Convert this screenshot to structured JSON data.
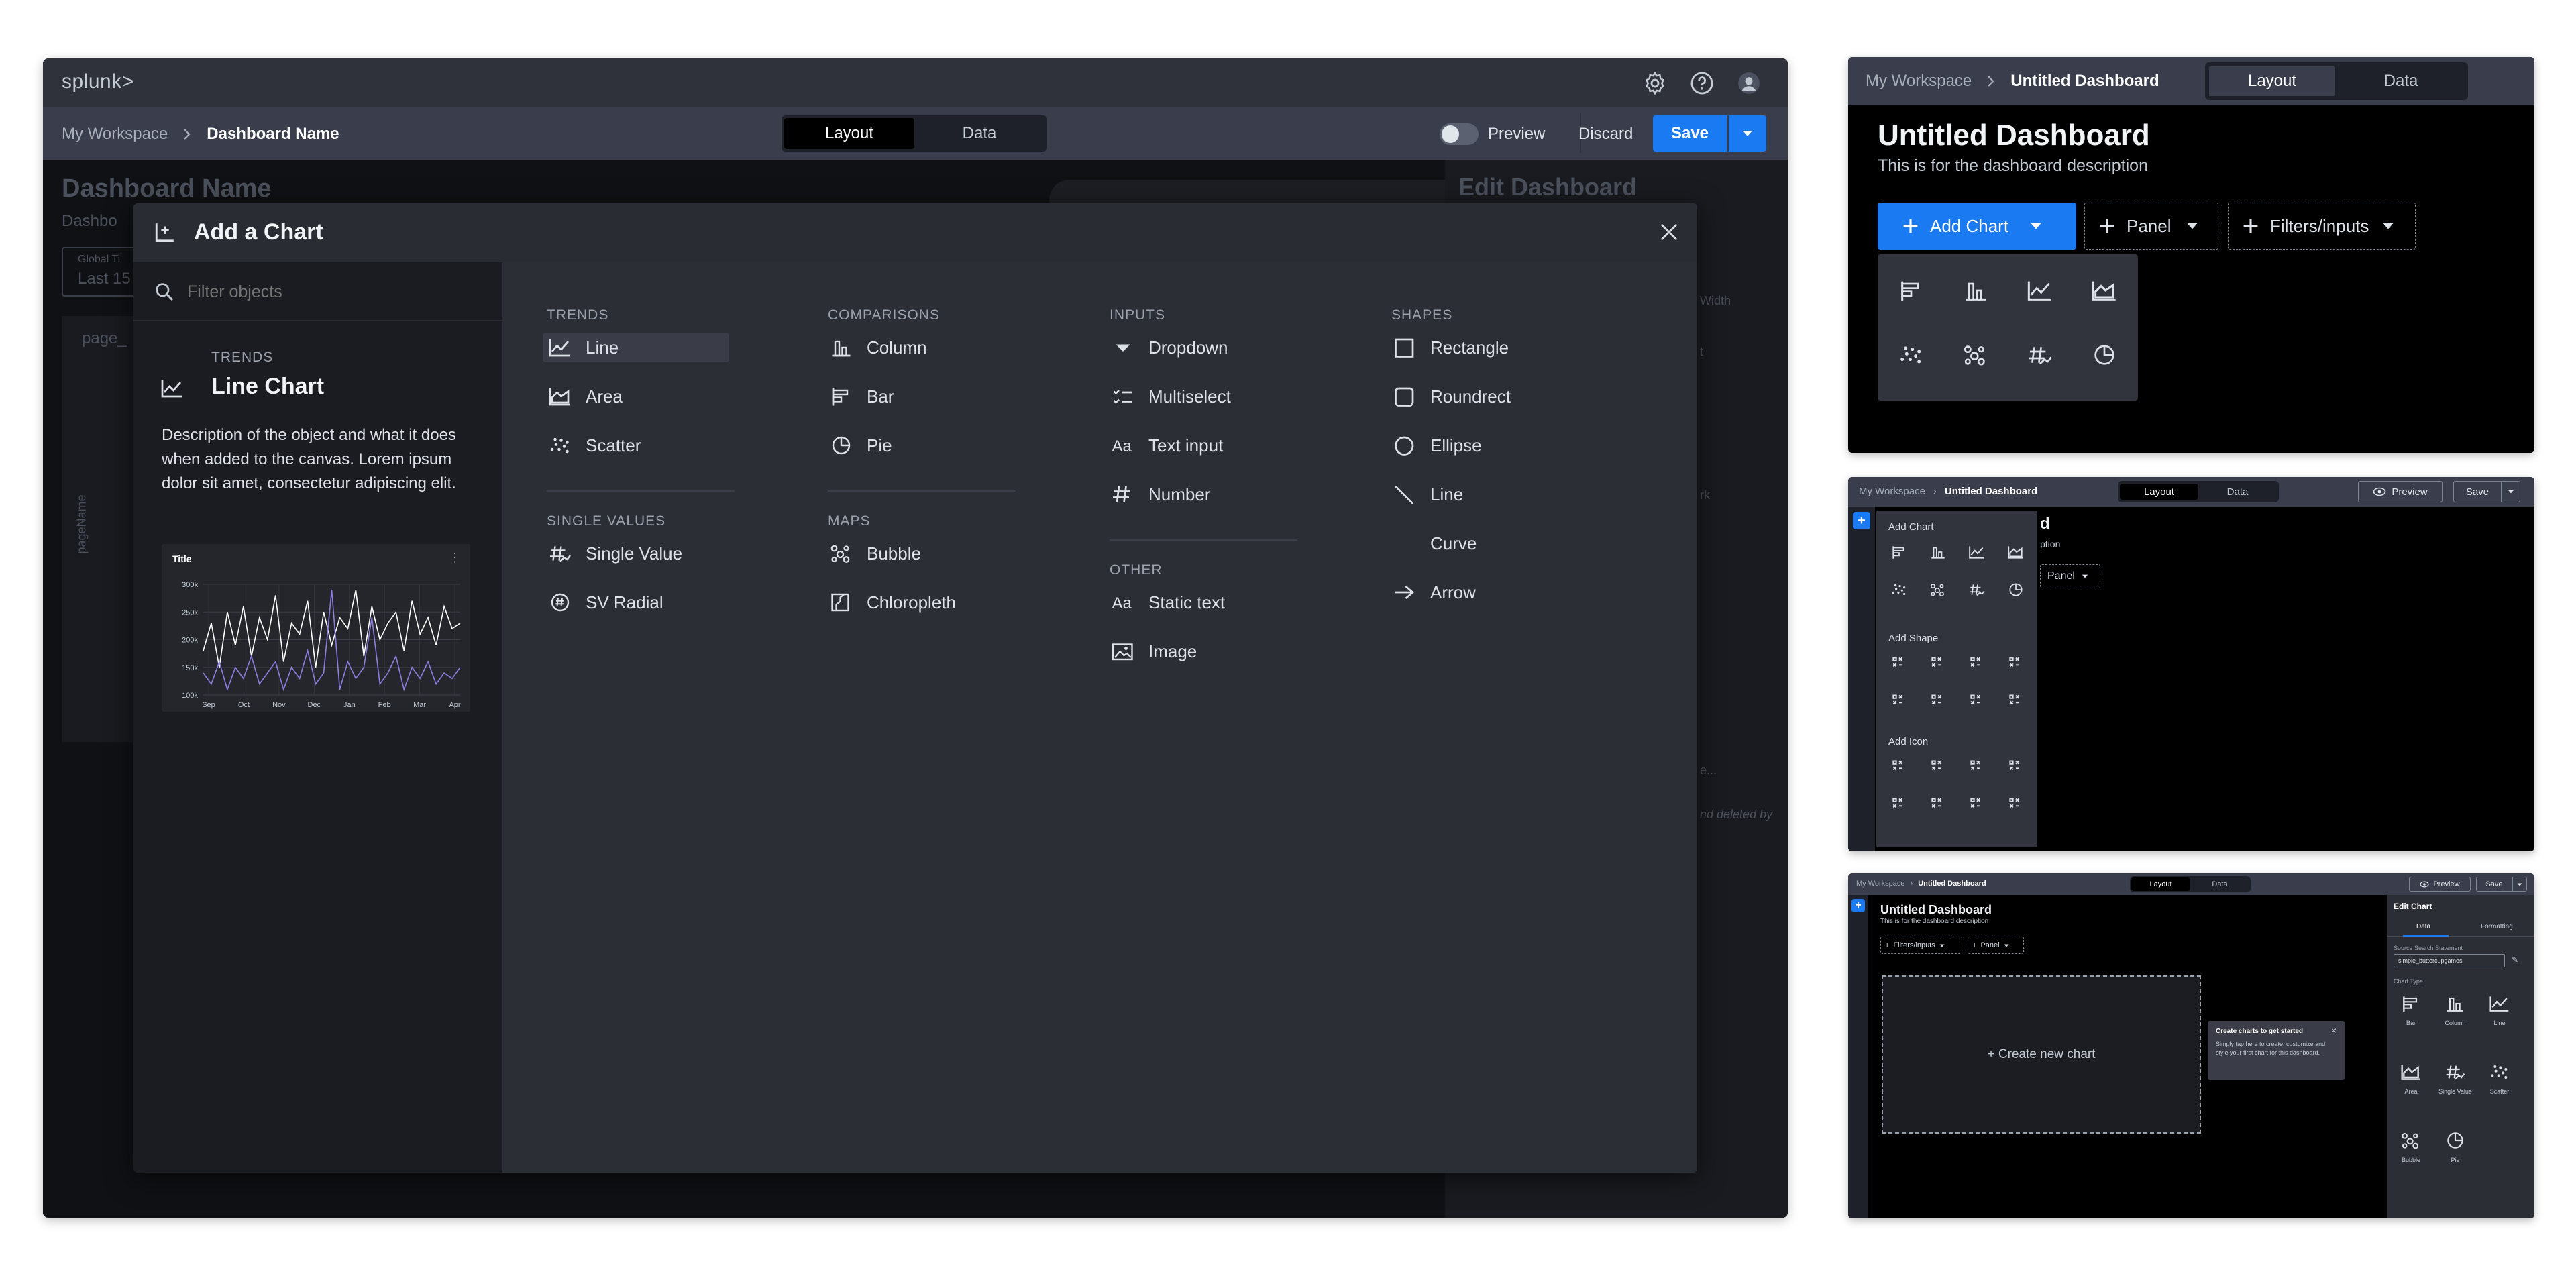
{
  "main": {
    "logo": "splunk>",
    "breadcrumb": {
      "workspace": "My Workspace",
      "dashboard": "Dashboard Name"
    },
    "tabs": [
      {
        "label": "Layout"
      },
      {
        "label": "Data"
      }
    ],
    "preview_label": "Preview",
    "discard_label": "Discard",
    "save_label": "Save",
    "bg": {
      "title": "Dashboard Name",
      "desc": "Dashbo",
      "time_label": "Global Ti",
      "time_value": "Last 15",
      "page": "page_",
      "vertical": "pageName",
      "edit_title": "Edit Dashboard",
      "width": "Width",
      "t1": "t",
      "t2": "rk",
      "t3": "e...",
      "t4": "nd deleted by"
    }
  },
  "modal": {
    "title": "Add a Chart",
    "search_placeholder": "Filter objects",
    "preview": {
      "category": "TRENDS",
      "name": "Line Chart",
      "description": "Description of the object and what it does when added to the canvas. Lorem ipsum dolor sit amet, consectetur adipiscing elit.",
      "chart_title": "Title"
    },
    "columns": [
      {
        "sections": [
          {
            "title": "TRENDS",
            "items": [
              {
                "label": "Line",
                "icon": "line-chart-icon"
              },
              {
                "label": "Area",
                "icon": "area-chart-icon"
              },
              {
                "label": "Scatter",
                "icon": "scatter-chart-icon"
              }
            ]
          },
          {
            "title": "SINGLE VALUES",
            "items": [
              {
                "label": "Single Value",
                "icon": "single-value-icon"
              },
              {
                "label": "SV Radial",
                "icon": "sv-radial-icon"
              }
            ]
          }
        ]
      },
      {
        "sections": [
          {
            "title": "COMPARISONS",
            "items": [
              {
                "label": "Column",
                "icon": "column-chart-icon"
              },
              {
                "label": "Bar",
                "icon": "bar-chart-icon"
              },
              {
                "label": "Pie",
                "icon": "pie-chart-icon"
              }
            ]
          },
          {
            "title": "MAPS",
            "items": [
              {
                "label": "Bubble",
                "icon": "bubble-chart-icon"
              },
              {
                "label": "Chloropleth",
                "icon": "choropleth-icon"
              }
            ]
          }
        ]
      },
      {
        "sections": [
          {
            "title": "INPUTS",
            "items": [
              {
                "label": "Dropdown",
                "icon": "dropdown-icon"
              },
              {
                "label": "Multiselect",
                "icon": "multiselect-icon"
              },
              {
                "label": "Text input",
                "icon": "text-input-icon"
              },
              {
                "label": "Number",
                "icon": "number-icon"
              }
            ]
          },
          {
            "title": "OTHER",
            "items": [
              {
                "label": "Static text",
                "icon": "static-text-icon"
              },
              {
                "label": "Image",
                "icon": "image-icon"
              }
            ]
          }
        ]
      },
      {
        "sections": [
          {
            "title": "SHAPES",
            "items": [
              {
                "label": "Rectangle",
                "icon": "rectangle-icon"
              },
              {
                "label": "Roundrect",
                "icon": "roundrect-icon"
              },
              {
                "label": "Ellipse",
                "icon": "ellipse-icon"
              },
              {
                "label": "Line",
                "icon": "line-shape-icon"
              },
              {
                "label": "Curve",
                "icon": "curve-icon"
              },
              {
                "label": "Arrow",
                "icon": "arrow-icon"
              }
            ]
          }
        ]
      }
    ]
  },
  "chart_data": {
    "type": "line",
    "title": "Title",
    "categories": [
      "Sep",
      "Oct",
      "Nov",
      "Dec",
      "Jan",
      "Feb",
      "Mar",
      "Apr"
    ],
    "ylim": [
      100000,
      300000
    ],
    "yticks": [
      "300k",
      "250k",
      "200k",
      "150k",
      "100k"
    ],
    "series": [
      {
        "values": [
          180000,
          230000,
          150000,
          250000,
          190000,
          260000,
          170000,
          240000,
          200000,
          280000,
          160000,
          230000,
          210000,
          270000,
          150000,
          250000,
          190000,
          240000,
          220000,
          290000,
          170000,
          260000,
          200000,
          230000,
          250000,
          180000,
          270000,
          210000,
          240000,
          190000,
          260000,
          220000,
          230000
        ]
      },
      {
        "values": [
          140000,
          120000,
          160000,
          110000,
          150000,
          130000,
          170000,
          120000,
          140000,
          160000,
          110000,
          150000,
          130000,
          180000,
          120000,
          140000,
          290000,
          110000,
          160000,
          130000,
          150000,
          240000,
          120000,
          140000,
          170000,
          110000,
          150000,
          130000,
          160000,
          120000,
          140000,
          130000,
          150000
        ]
      }
    ]
  },
  "win1": {
    "breadcrumb": {
      "workspace": "My Workspace",
      "dashboard": "Untitled Dashboard"
    },
    "tabs": [
      {
        "label": "Layout"
      },
      {
        "label": "Data"
      }
    ],
    "title": "Untitled Dashboard",
    "description": "This is for the dashboard description",
    "add_chart": "Add Chart",
    "panel": "Panel",
    "filters": "Filters/inputs"
  },
  "win2": {
    "breadcrumb": {
      "workspace": "My Workspace",
      "dashboard": "Untitled Dashboard"
    },
    "tabs": [
      {
        "label": "Layout"
      },
      {
        "label": "Data"
      }
    ],
    "preview": "Preview",
    "save": "Save",
    "add_chart": "Add Chart",
    "add_shape": "Add Shape",
    "add_icon": "Add Icon",
    "title_partial": "d",
    "desc_partial": "ption",
    "panel": "Panel"
  },
  "win3": {
    "breadcrumb": {
      "workspace": "My Workspace",
      "dashboard": "Untitled Dashboard"
    },
    "tabs": [
      {
        "label": "Layout"
      },
      {
        "label": "Data"
      }
    ],
    "preview": "Preview",
    "save": "Save",
    "title": "Untitled Dashboard",
    "description": "This is for the dashboard description",
    "filters": "Filters/inputs",
    "panel": "Panel",
    "create": "+ Create new chart",
    "tooltip_title": "Create charts to get started",
    "tooltip_body": "Simply tap here to create, customize and style your first chart for this dashboard.",
    "edit_chart": "Edit Chart",
    "edit_tabs": [
      {
        "label": "Data"
      },
      {
        "label": "Formatting"
      }
    ],
    "source_label": "Source Search Statement",
    "source_value": "simple_buttercupgames",
    "chart_type_label": "Chart Type",
    "chart_types": [
      {
        "label": "Bar",
        "icon": "bar-chart-icon"
      },
      {
        "label": "Column",
        "icon": "column-chart-icon"
      },
      {
        "label": "Line",
        "icon": "line-chart-icon"
      },
      {
        "label": "Area",
        "icon": "area-chart-icon"
      },
      {
        "label": "Single Value",
        "icon": "single-value-icon"
      },
      {
        "label": "Scatter",
        "icon": "scatter-chart-icon"
      },
      {
        "label": "Bubble",
        "icon": "bubble-chart-icon"
      },
      {
        "label": "Pie",
        "icon": "pie-chart-icon"
      }
    ]
  }
}
